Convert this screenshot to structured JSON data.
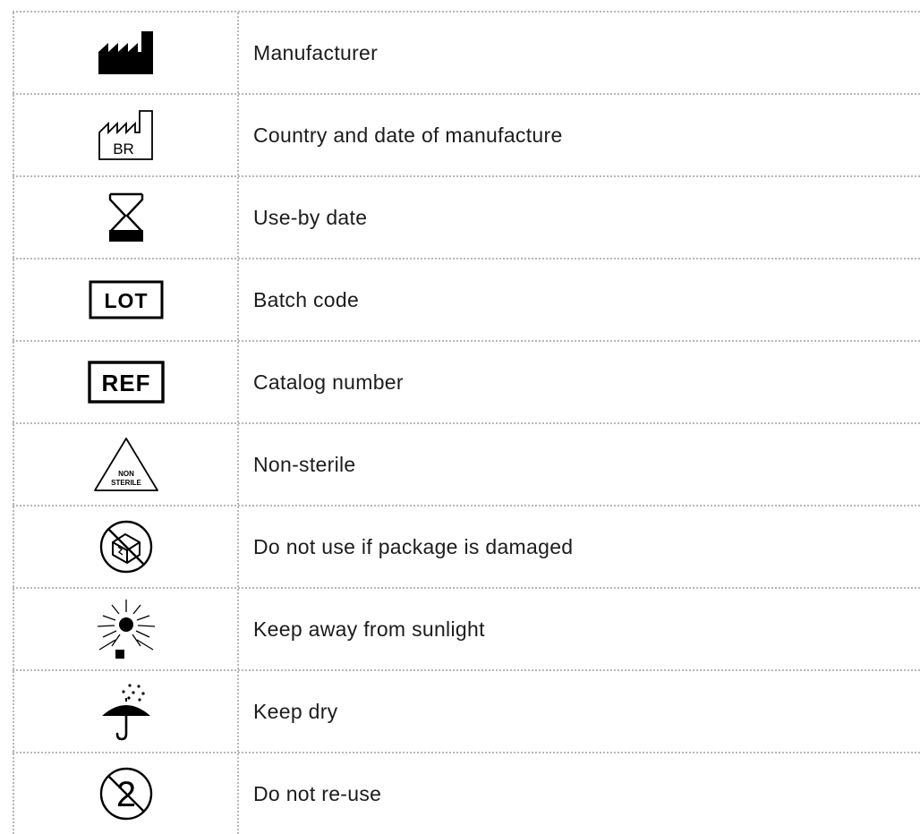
{
  "symbols": [
    {
      "icon": "manufacturer-icon",
      "label": "Manufacturer"
    },
    {
      "icon": "country-date-manufacture-icon",
      "label": "Country and date of manufacture",
      "icon_text": "BR"
    },
    {
      "icon": "hourglass-icon",
      "label": "Use-by date"
    },
    {
      "icon": "lot-icon",
      "label": "Batch code",
      "icon_text": "LOT"
    },
    {
      "icon": "ref-icon",
      "label": "Catalog number",
      "icon_text": "REF"
    },
    {
      "icon": "non-sterile-icon",
      "label": "Non-sterile",
      "icon_text_1": "NON",
      "icon_text_2": "STERILE"
    },
    {
      "icon": "damaged-package-icon",
      "label": "Do not use if package is damaged"
    },
    {
      "icon": "sunlight-icon",
      "label": "Keep away from sunlight"
    },
    {
      "icon": "umbrella-icon",
      "label": "Keep dry"
    },
    {
      "icon": "single-use-icon",
      "label": "Do not re-use",
      "icon_text": "2"
    }
  ]
}
